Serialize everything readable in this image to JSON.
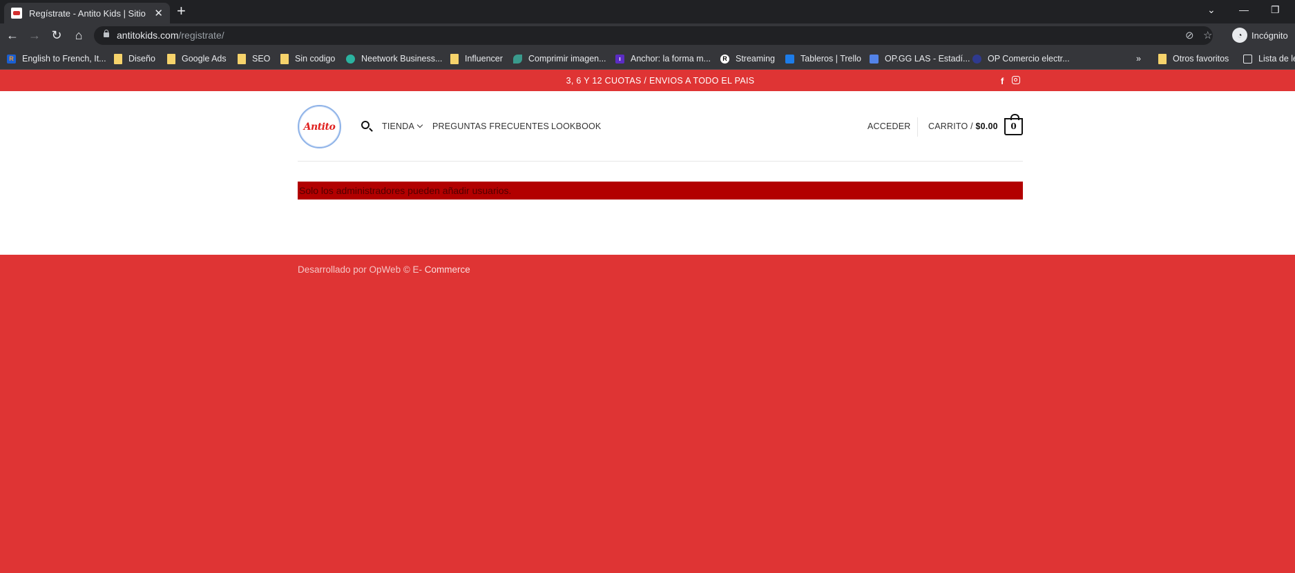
{
  "browser": {
    "tab_title": "Regístrate - Antito Kids | Sitio Of",
    "tab_close": "✕",
    "new_tab": "+",
    "url_host": "antitokids.com",
    "url_path": "/registrate/",
    "incognito_label": "Incógnito",
    "window_minimize": "—",
    "window_restore": "❐",
    "bookmarks": [
      {
        "label": "English to French, It...",
        "icon": "translate-icon"
      },
      {
        "label": "Diseño",
        "icon": "folder-icon"
      },
      {
        "label": "Google Ads",
        "icon": "folder-icon"
      },
      {
        "label": "SEO",
        "icon": "folder-icon"
      },
      {
        "label": "Sin codigo",
        "icon": "folder-icon"
      },
      {
        "label": "Neetwork Business...",
        "icon": "link-icon"
      },
      {
        "label": "Influencer",
        "icon": "folder-icon"
      },
      {
        "label": "Comprimir imagen...",
        "icon": "leaf-icon"
      },
      {
        "label": "Anchor: la forma m...",
        "icon": "podcast-icon"
      },
      {
        "label": "Streaming",
        "icon": "r-icon"
      },
      {
        "label": "Tableros | Trello",
        "icon": "trello-icon"
      },
      {
        "label": "OP.GG LAS - Estadí...",
        "icon": "opgg-icon"
      },
      {
        "label": "OP Comercio electr...",
        "icon": "globe-icon"
      },
      {
        "label": "»",
        "icon": "more-icon"
      },
      {
        "label": "Otros favoritos",
        "icon": "folder-icon"
      },
      {
        "label": "Lista de le",
        "icon": "reading-list-icon"
      }
    ]
  },
  "site": {
    "top_banner": "3, 6 Y 12 CUOTAS / ENVIOS A TODO EL PAIS",
    "logo_text": "Antito",
    "nav": {
      "tienda": "TIENDA",
      "faq": "PREGUNTAS FRECUENTES",
      "lookbook": "LOOKBOOK",
      "acceder": "ACCEDER",
      "carrito": "CARRITO /",
      "cart_amount": "$0.00",
      "cart_count": "0"
    },
    "error_message": "Solo los administradores pueden añadir usuarios.",
    "footer": {
      "prefix": "Desarrollado por OpWeb © E- ",
      "link": "Commerce"
    }
  },
  "colors": {
    "brand_red": "#df3434",
    "error_red": "#b20000",
    "chrome_dark": "#202124"
  }
}
